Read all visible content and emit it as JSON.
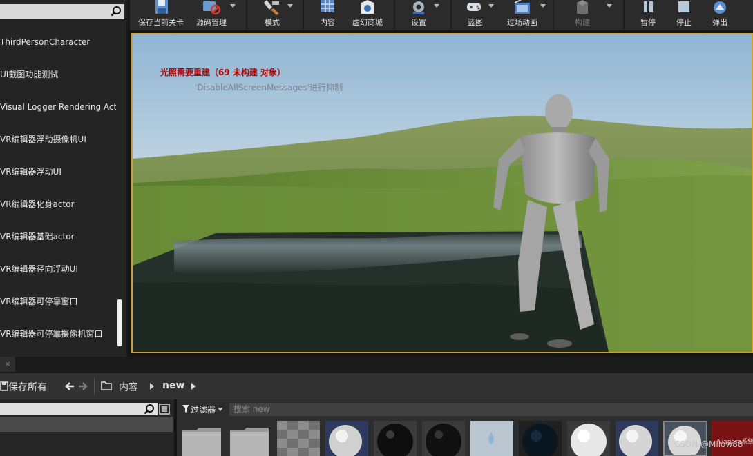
{
  "left_panel": {
    "actors": [
      "ThirdPersonCharacter",
      "UI截图功能测试",
      "Visual Logger Rendering Actc",
      "VR编辑器浮动摄像机UI",
      "VR编辑器浮动UI",
      "VR编辑器化身actor",
      "VR编辑器基础actor",
      "VR编辑器径向浮动UI",
      "VR编辑器可停靠窗口",
      "VR编辑器可停靠摄像机窗口"
    ]
  },
  "toolbar": {
    "buttons": [
      {
        "label": "保存当前关卡",
        "icon": "save-icon"
      },
      {
        "label": "源码管理",
        "icon": "source-control-icon"
      },
      {
        "label": "模式",
        "icon": "modes-icon"
      },
      {
        "label": "内容",
        "icon": "content-icon"
      },
      {
        "label": "虚幻商城",
        "icon": "marketplace-icon"
      },
      {
        "label": "设置",
        "icon": "settings-icon"
      },
      {
        "label": "蓝图",
        "icon": "blueprint-icon"
      },
      {
        "label": "过场动画",
        "icon": "cinematics-icon"
      },
      {
        "label": "构建",
        "icon": "build-icon"
      },
      {
        "label": "暂停",
        "icon": "pause-icon"
      },
      {
        "label": "停止",
        "icon": "stop-icon"
      },
      {
        "label": "弹出",
        "icon": "eject-icon"
      }
    ]
  },
  "viewport": {
    "warning": "光照需要重建（69 未构建 对象）",
    "suppressed": "'DisableAllScreenMessages'进行抑制"
  },
  "content_browser": {
    "tab_close": "×",
    "save_all": "保存所有",
    "path": [
      "内容",
      "new"
    ],
    "filter_label": "过滤器",
    "search_placeholder": "搜索 new",
    "last_tile_label": "Niagara系统"
  },
  "watermark": "CSDN @Milow88"
}
